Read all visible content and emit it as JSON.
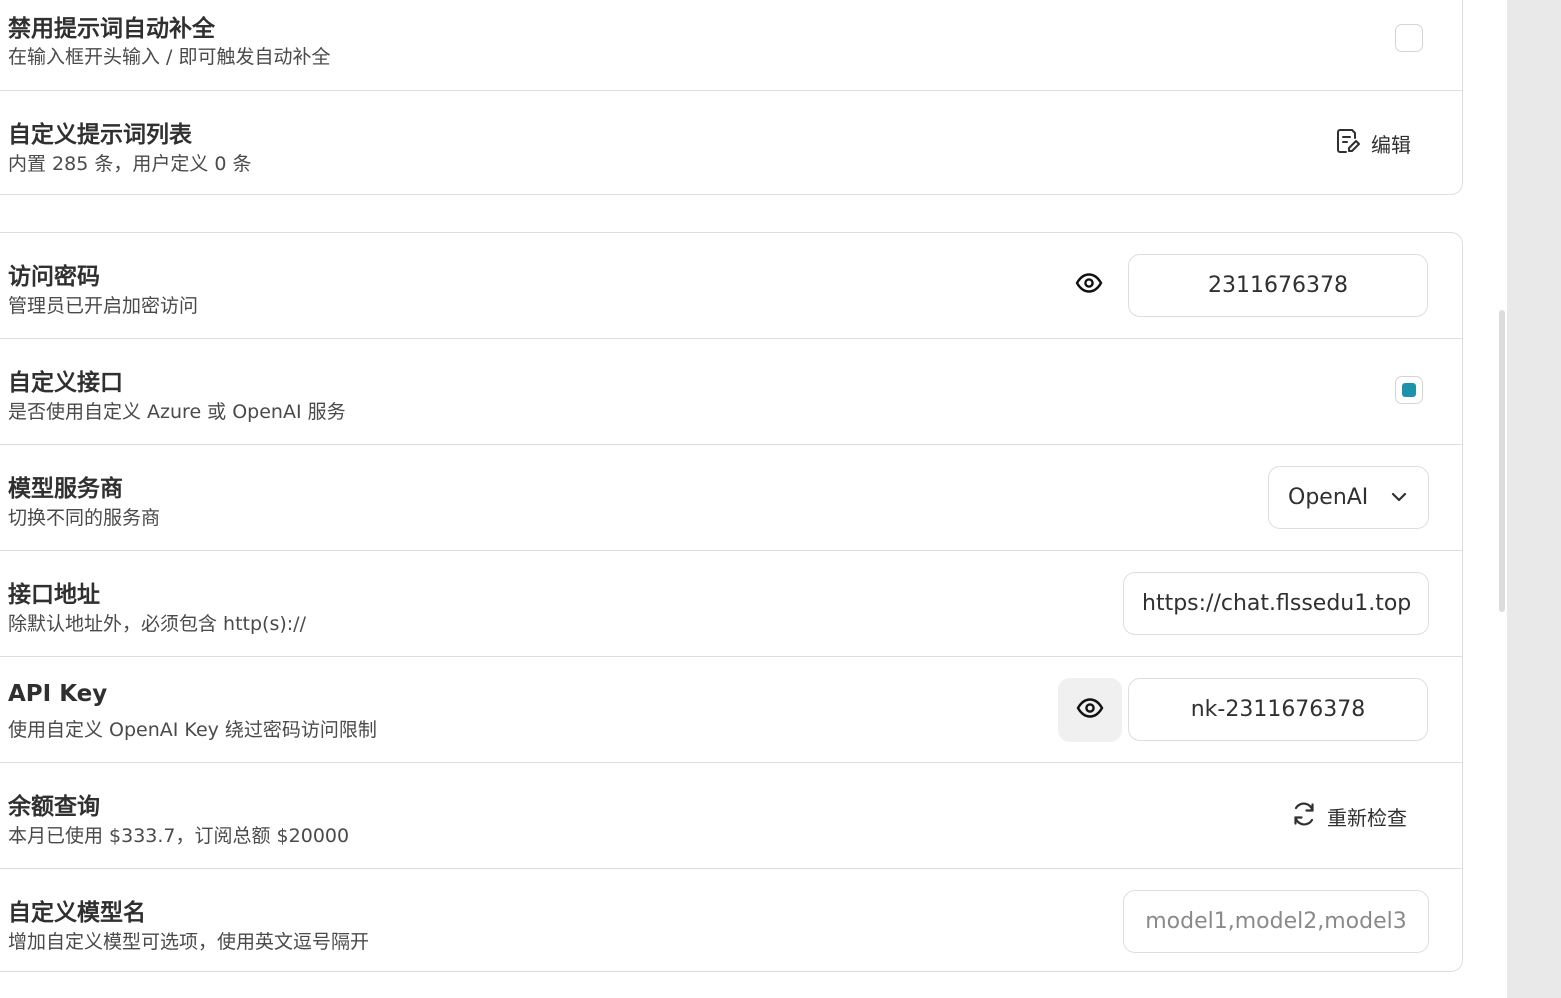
{
  "settings_top": {
    "disable_autocomplete": {
      "title": "禁用提示词自动补全",
      "subtitle": "在输入框开头输入 / 即可触发自动补全",
      "checked": false
    },
    "custom_prompts": {
      "title": "自定义提示词列表",
      "subtitle": "内置 285 条，用户定义 0 条",
      "edit_label": "编辑"
    }
  },
  "settings_api": {
    "access_password": {
      "title": "访问密码",
      "subtitle": "管理员已开启加密访问",
      "value": "2311676378"
    },
    "custom_endpoint": {
      "title": "自定义接口",
      "subtitle": "是否使用自定义 Azure 或 OpenAI 服务",
      "checked": true
    },
    "provider": {
      "title": "模型服务商",
      "subtitle": "切换不同的服务商",
      "selected": "OpenAI"
    },
    "endpoint_url": {
      "title": "接口地址",
      "subtitle": "除默认地址外，必须包含 http(s)://",
      "value": "https://chat.flssedu1.top"
    },
    "api_key": {
      "title": "API Key",
      "subtitle": "使用自定义 OpenAI Key 绕过密码访问限制",
      "value": "nk-2311676378"
    },
    "balance": {
      "title": "余额查询",
      "subtitle": "本月已使用 $333.7，订阅总额 $20000",
      "recheck_label": "重新检查"
    },
    "custom_models": {
      "title": "自定义模型名",
      "subtitle": "增加自定义模型可选项，使用英文逗号隔开",
      "placeholder": "model1,model2,model3"
    }
  },
  "colors": {
    "accent": "#1d93ab",
    "border": "#dedede",
    "text": "#303030"
  }
}
